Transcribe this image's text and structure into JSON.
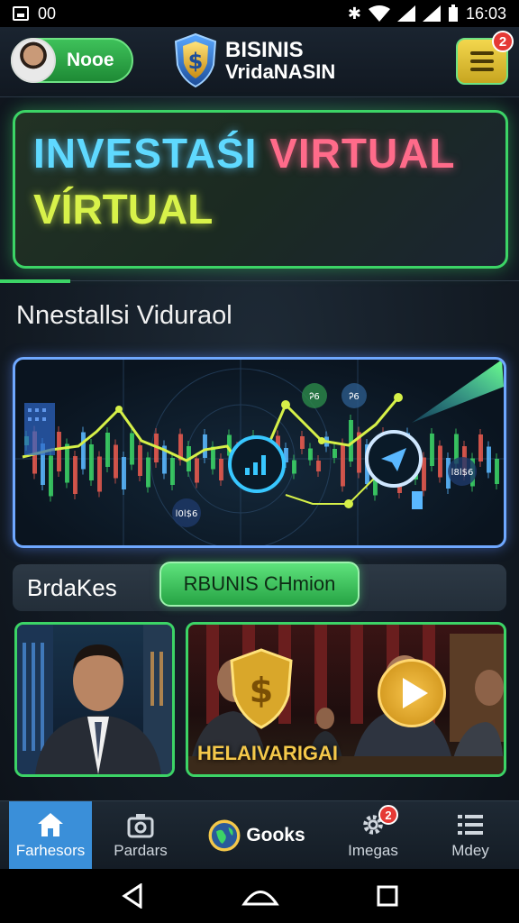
{
  "status_bar": {
    "left_text": "00",
    "time": "16:03"
  },
  "header": {
    "user_name": "Nooe",
    "brand_line1": "BISINIS",
    "brand_line2": "VridaNASIN",
    "menu_badge": "2"
  },
  "hero": {
    "line1_part1": "INVESTAŚI",
    "line1_part2": "VIRTUAL",
    "line2": "VÍRTUAL"
  },
  "section_title": "Nnestallsi Viduraol",
  "chart_labels": {
    "label_a": "Ꭾ6",
    "label_b": "Ꭾ6",
    "label_c": "l0l$6",
    "label_d": "l8l$6"
  },
  "filter": {
    "label": "BrdaKes",
    "chip": "RBUNIS CHmion"
  },
  "videos": {
    "caption": "HELAIVARIGAI"
  },
  "bottom_nav": [
    {
      "label": "Farhesors",
      "icon": "home-icon"
    },
    {
      "label": "Pardars",
      "icon": "camera-icon"
    },
    {
      "label": "Gooks",
      "icon": "globe-icon"
    },
    {
      "label": "Imegas",
      "icon": "gear-icon",
      "badge": "2"
    },
    {
      "label": "Mdey",
      "icon": "list-icon"
    }
  ],
  "colors": {
    "accent_green": "#3cd466",
    "accent_blue": "#3a8fd9",
    "gold": "#f4c84a"
  }
}
